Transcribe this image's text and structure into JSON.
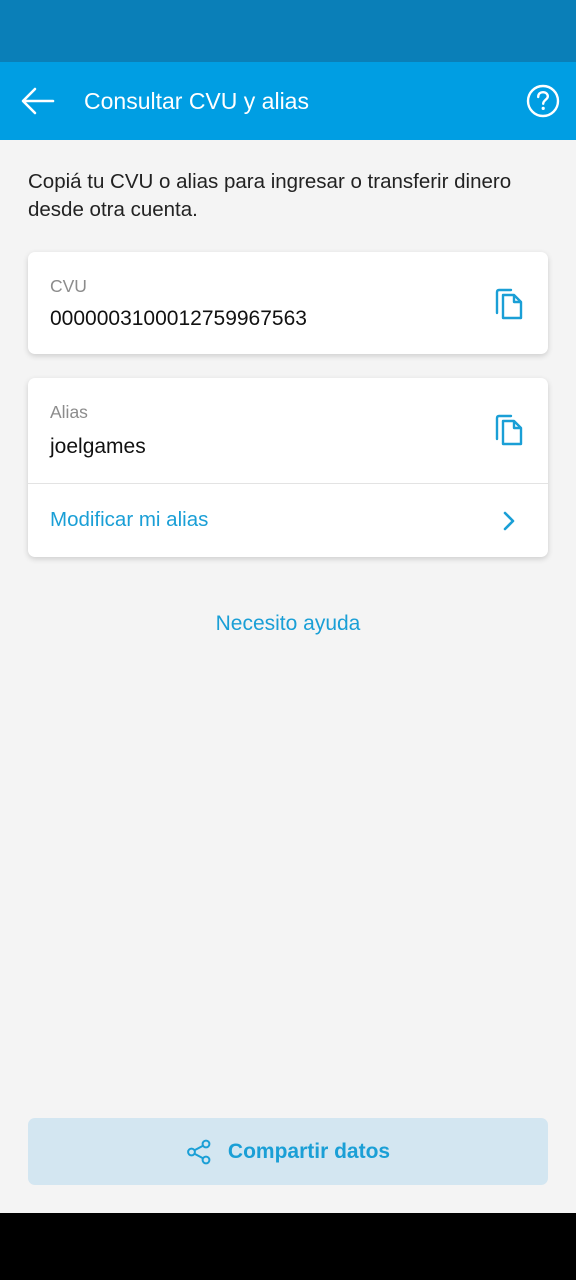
{
  "header": {
    "title": "Consultar CVU y alias",
    "back_icon": "arrow-left-icon",
    "help_icon": "question-circle-icon"
  },
  "intro": "Copiá tu CVU o alias para ingresar o transferir dinero desde otra cuenta.",
  "cvu": {
    "label": "CVU",
    "value": "0000003100012759967563",
    "copy_icon": "copy-icon"
  },
  "alias": {
    "label": "Alias",
    "value": "joelgames",
    "copy_icon": "copy-icon",
    "modify_label": "Modificar mi alias",
    "modify_icon": "chevron-right-icon"
  },
  "help_link": "Necesito ayuda",
  "share": {
    "label": "Compartir datos",
    "icon": "share-icon"
  },
  "colors": {
    "status_bar": "#0a7fb8",
    "app_bar": "#009ee3",
    "accent": "#1a9fd6",
    "background": "#f4f4f4",
    "share_button_bg": "#d3e6f1"
  }
}
